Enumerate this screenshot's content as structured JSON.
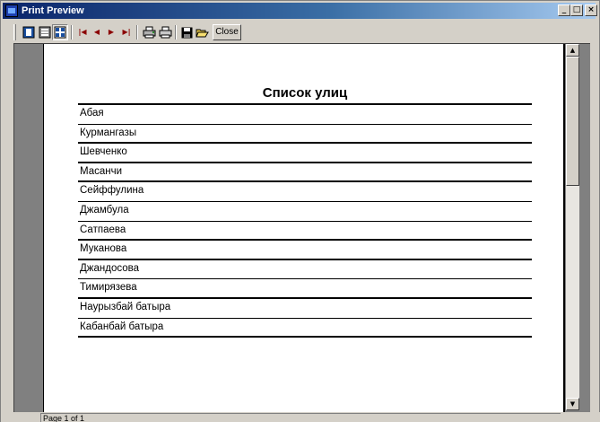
{
  "window": {
    "title": "Print Preview",
    "caption_buttons": [
      "_",
      "□",
      "×"
    ]
  },
  "toolbar": {
    "buttons": [
      {
        "name": "single-page",
        "icon": "single-page-icon"
      },
      {
        "name": "two-pages",
        "icon": "two-pages-icon"
      },
      {
        "name": "multi-pages",
        "icon": "multi-pages-icon"
      },
      {
        "name": "first-page",
        "icon": "first-page-icon"
      },
      {
        "name": "prev-page",
        "icon": "prev-page-icon"
      },
      {
        "name": "next-page",
        "icon": "next-page-icon"
      },
      {
        "name": "last-page",
        "icon": "last-page-icon"
      },
      {
        "name": "printer-setup",
        "icon": "printer-setup-icon"
      },
      {
        "name": "print",
        "icon": "printer-icon"
      },
      {
        "name": "save",
        "icon": "floppy-disk-icon"
      },
      {
        "name": "open",
        "icon": "open-folder-icon"
      }
    ],
    "close_label": "Close"
  },
  "report": {
    "title": "Список улиц",
    "streets": [
      "Абая",
      "Курмангазы",
      "Шевченко",
      "Масанчи",
      "Сейффулина",
      "Джамбула",
      "Сатпаева",
      "Муканова",
      "Джандосова",
      "Тимирязева",
      "Наурызбай батыра",
      "Кабанбай батыра"
    ]
  },
  "status": {
    "page_text": "Page 1 of 1"
  },
  "colors": {
    "title_bar_start": "#0a246a",
    "title_bar_end": "#a6caf0",
    "viewport_bg": "#808080"
  }
}
